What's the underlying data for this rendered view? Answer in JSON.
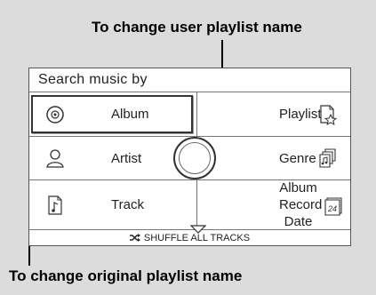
{
  "callouts": {
    "top": "To change user playlist name",
    "bottom": "To change original playlist name"
  },
  "screen": {
    "title": "Search music by",
    "items": {
      "album": {
        "label": "Album",
        "icon": "disc-icon"
      },
      "playlist": {
        "label": "Playlist",
        "icon": "playlist-star-icon"
      },
      "artist": {
        "label": "Artist",
        "icon": "person-icon"
      },
      "genre": {
        "label": "Genre",
        "icon": "genre-files-icon"
      },
      "track": {
        "label": "Track",
        "icon": "music-note-file-icon"
      },
      "album_record_date": {
        "label_line1": "Album Record",
        "label_line2": "Date",
        "icon": "calendar-icon",
        "calendar_number": "24"
      }
    },
    "shuffle": {
      "label": "SHUFFLE ALL TRACKS",
      "icon": "shuffle-icon"
    }
  },
  "colors": {
    "background": "#dcdcdc",
    "screen": "#ffffff",
    "lines": "#777777",
    "text": "#222222"
  }
}
